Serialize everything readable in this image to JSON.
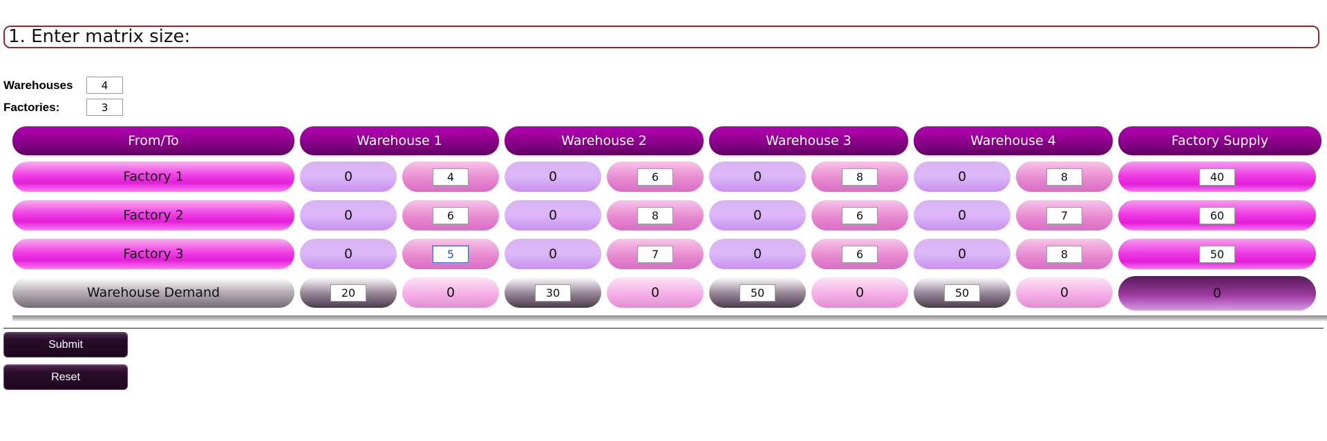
{
  "step": {
    "title": "1. Enter matrix size:"
  },
  "size": {
    "warehouses_label": "Warehouses",
    "warehouses_value": "4",
    "factories_label": "Factories:",
    "factories_value": "3"
  },
  "headers": [
    "From/To",
    "Warehouse 1",
    "Warehouse 2",
    "Warehouse 3",
    "Warehouse 4",
    "Factory Supply"
  ],
  "rows": [
    {
      "label": "Factory 1",
      "alloc": [
        "0",
        "0",
        "0",
        "0"
      ],
      "cost": [
        "4",
        "6",
        "8",
        "8"
      ],
      "supply": "40"
    },
    {
      "label": "Factory 2",
      "alloc": [
        "0",
        "0",
        "0",
        "0"
      ],
      "cost": [
        "6",
        "8",
        "6",
        "7"
      ],
      "supply": "60"
    },
    {
      "label": "Factory 3",
      "alloc": [
        "0",
        "0",
        "0",
        "0"
      ],
      "cost": [
        "5",
        "7",
        "6",
        "8"
      ],
      "supply": "50"
    }
  ],
  "demand": {
    "label": "Warehouse Demand",
    "values": [
      "20",
      "30",
      "50",
      "50"
    ],
    "remaining": [
      "0",
      "0",
      "0",
      "0"
    ],
    "total": "0"
  },
  "buttons": {
    "submit": "Submit",
    "reset": "Reset"
  },
  "colors": {
    "header": "#930093",
    "border": "#8b2a2a",
    "button": "#2a0c2a"
  }
}
